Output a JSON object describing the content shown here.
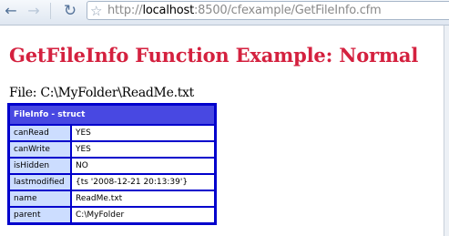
{
  "browser": {
    "url_prefix": "http://",
    "url_host": "localhost",
    "url_rest": ":8500/cfexample/GetFileInfo.cfm",
    "icons": {
      "back": "arrow-left-icon",
      "forward": "arrow-right-icon",
      "reload": "reload-icon",
      "bookmark": "star-icon"
    }
  },
  "page": {
    "title": "GetFileInfo Function Example: Normal",
    "file_label": "File: C:\\MyFolder\\ReadMe.txt"
  },
  "dump": {
    "header": "FileInfo - struct",
    "rows": [
      {
        "key": "canRead",
        "value": "YES"
      },
      {
        "key": "canWrite",
        "value": "YES"
      },
      {
        "key": "isHidden",
        "value": "NO"
      },
      {
        "key": "lastmodified",
        "value": "{ts '2008-12-21 20:13:39'}"
      },
      {
        "key": "name",
        "value": "ReadMe.txt"
      },
      {
        "key": "parent",
        "value": "C:\\MyFolder"
      }
    ]
  },
  "colors": {
    "title": "#d4213f",
    "dump_border": "#0000cc",
    "dump_header": "#4848e2",
    "dump_key_bg": "#ccddff"
  }
}
